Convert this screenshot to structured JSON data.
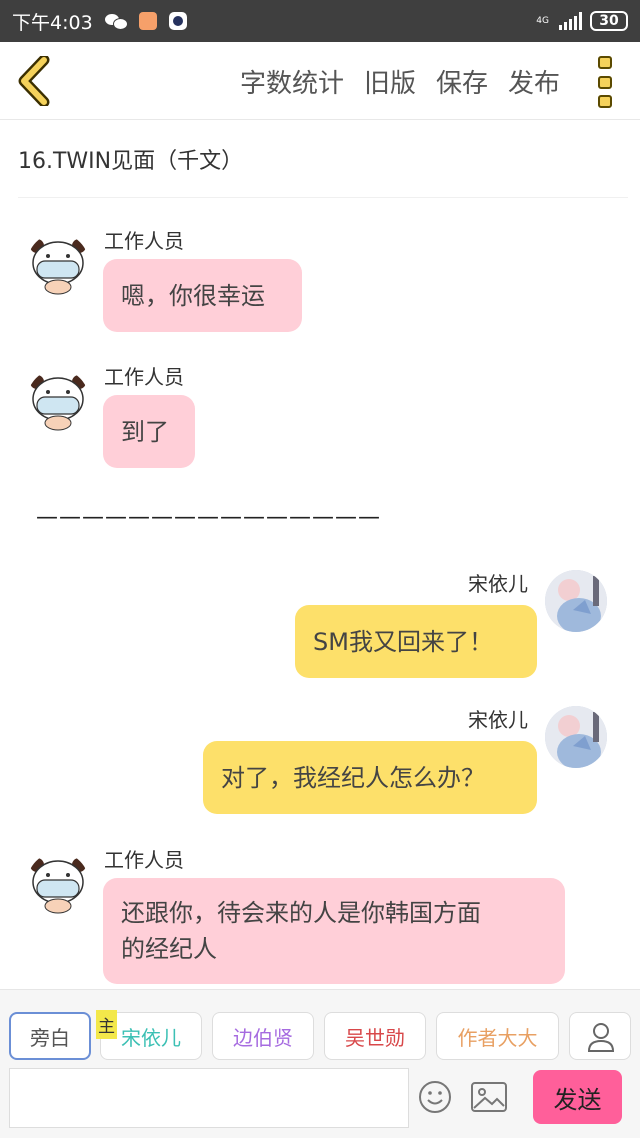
{
  "status_bar": {
    "time": "下午4:03",
    "network": "4G",
    "battery": "30"
  },
  "toolbar": {
    "items": [
      "字数统计",
      "旧版",
      "保存",
      "发布"
    ],
    "back_icon": "chevron-left-icon",
    "more_icon": "more-vertical-icon"
  },
  "chapter": {
    "title": "16.TWIN见面（千文）"
  },
  "messages": [
    {
      "speaker": "工作人员",
      "text": "嗯，你很幸运",
      "side": "left"
    },
    {
      "speaker": "工作人员",
      "text": "到了",
      "side": "left"
    },
    {
      "divider": "———————————————"
    },
    {
      "speaker": "宋依儿",
      "text": "SM我又回来了！",
      "side": "right"
    },
    {
      "speaker": "宋依儿",
      "text": "对了，我经纪人怎么办？",
      "side": "right"
    },
    {
      "speaker": "工作人员",
      "text": "还跟你，待会来的人是你韩国方面的经纪人",
      "text_line1": "还跟你，待会来的人是你韩国方面",
      "text_line2": "的经纪人",
      "side": "left"
    }
  ],
  "roles": [
    {
      "label": "旁白",
      "color": "#555555",
      "selected": true
    },
    {
      "label": "宋依儿",
      "color": "#3cc0b4",
      "main": true
    },
    {
      "label": "边伯贤",
      "color": "#a66be0"
    },
    {
      "label": "吴世勋",
      "color": "#d8484a"
    },
    {
      "label": "作者大大",
      "color": "#e8a063"
    }
  ],
  "main_tag": "主",
  "input": {
    "placeholder": "",
    "value": ""
  },
  "send_label": "发送",
  "colors": {
    "bubble_left": "#ffcfd8",
    "bubble_right": "#fde06a",
    "send": "#ff5f9a"
  }
}
